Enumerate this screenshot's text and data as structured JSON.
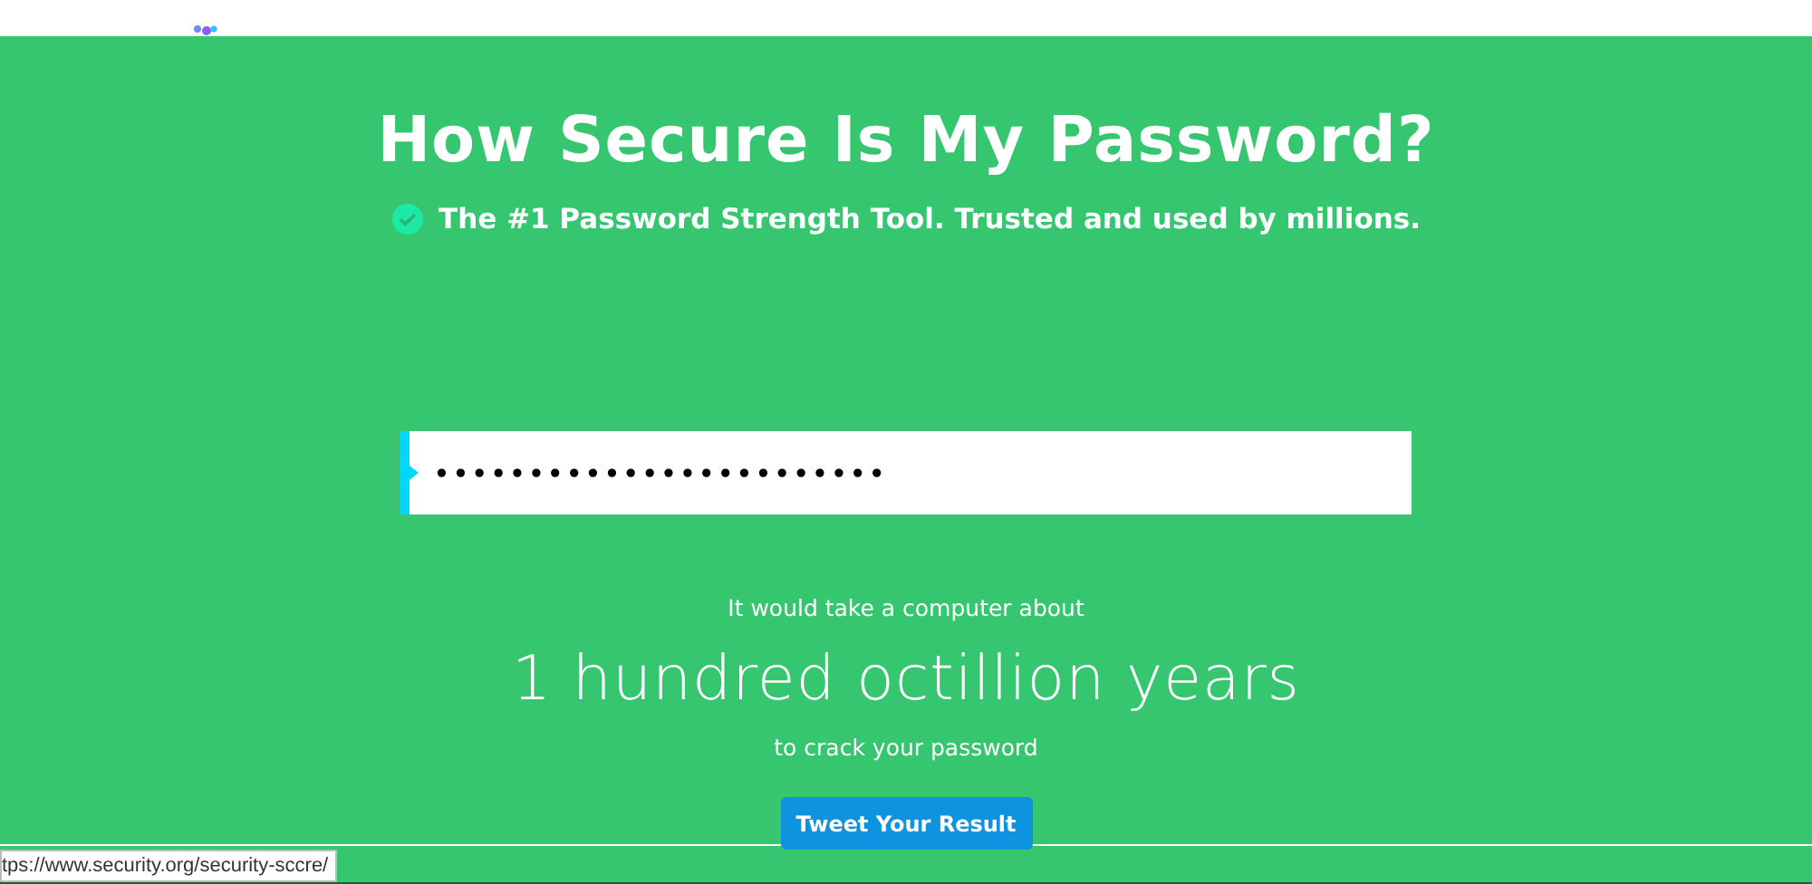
{
  "title": "How Secure Is My Password?",
  "tagline": "The #1 Password Strength Tool. Trusted and used by millions.",
  "password_field": {
    "value": "••••••••••••••••••••••••"
  },
  "result": {
    "intro": "It would take a computer about",
    "time": "1 hundred octillion years",
    "outro": "to crack your password"
  },
  "tweet_button": "Tweet Your Result",
  "status_bar": {
    "url": "tps://www.security.org/security-sccre/"
  }
}
